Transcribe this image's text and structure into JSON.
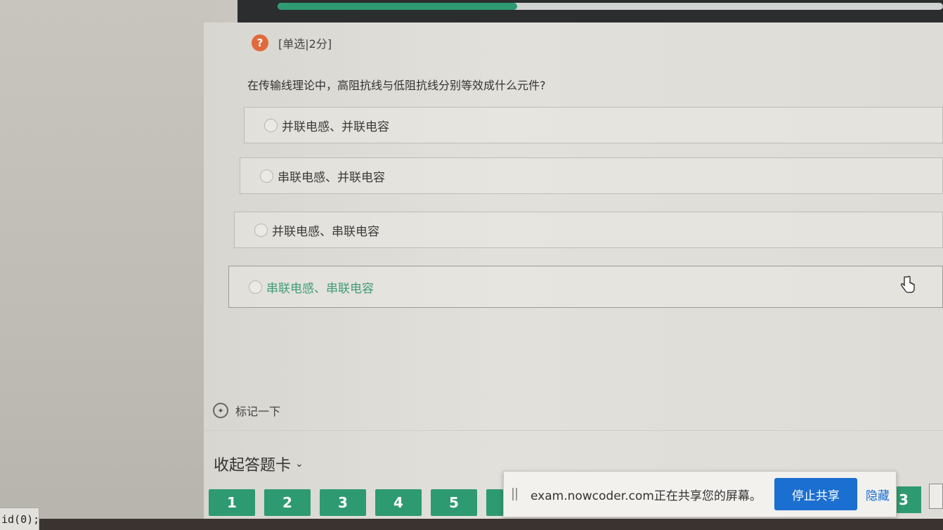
{
  "header": {
    "progress_percent": 36
  },
  "question": {
    "type_label": "[单选|2分]",
    "icon": "question-icon",
    "text": "在传输线理论中，高阻抗线与低阻抗线分别等效成什么元件?",
    "options": [
      {
        "label": "并联电感、并联电容",
        "selected": false
      },
      {
        "label": "串联电感、并联电容",
        "selected": false
      },
      {
        "label": "并联电感、串联电容",
        "selected": false
      },
      {
        "label": "串联电感、串联电容",
        "selected": true
      }
    ]
  },
  "mark": {
    "icon": "pin-icon",
    "label": "标记一下"
  },
  "answer_card": {
    "collapse_label": "收起答题卡",
    "chevron": "chevron-down-icon",
    "numbers": [
      "1",
      "2",
      "3",
      "4",
      "5"
    ],
    "partial_number": "3"
  },
  "share_bar": {
    "message": "exam.nowcoder.com正在共享您的屏幕。",
    "stop_label": "停止共享",
    "hide_label": "隐藏"
  },
  "status_bar": {
    "text": "id(0);"
  },
  "colors": {
    "accent_green": "#2e9a72",
    "selected_text": "#3f9c7a",
    "share_blue": "#1b6fd0",
    "question_icon": "#e06a3c"
  }
}
